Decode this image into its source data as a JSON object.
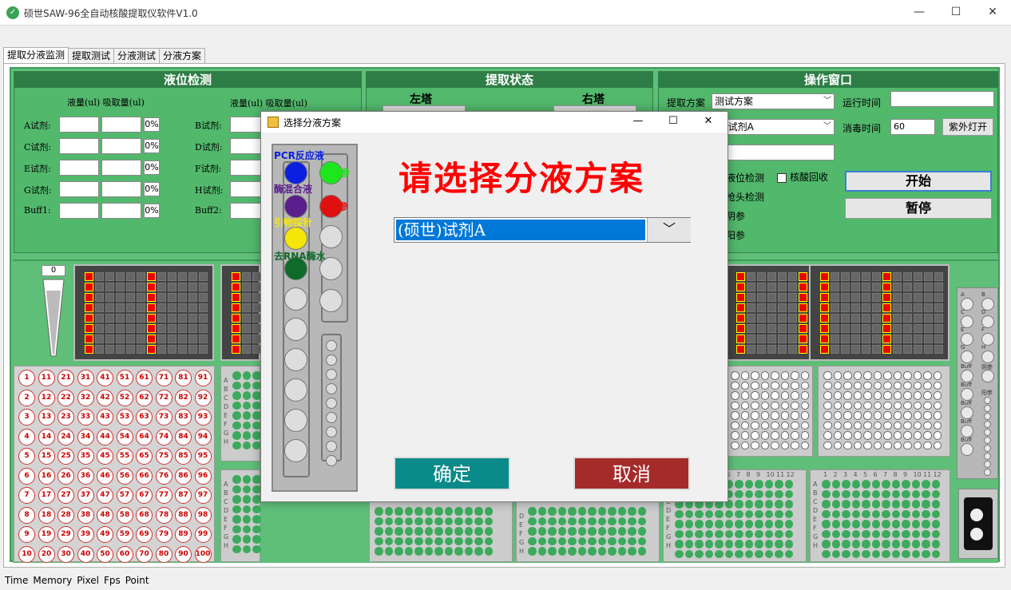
{
  "window": {
    "title": "硕世SAW-96全自动核酸提取仪软件V1.0",
    "minimize": "—",
    "maximize": "☐",
    "close": "✕"
  },
  "tabs": [
    "提取分液监测",
    "提取测试",
    "分液测试",
    "分液方案"
  ],
  "liquid_panel": {
    "title": "液位检测",
    "col_header_left": "液量(ul) 吸取量(ul)",
    "col_header_right": "液量(ul) 吸取量(ul)",
    "left_rows": [
      {
        "label": "A试剂:",
        "pct": "0%"
      },
      {
        "label": "C试剂:",
        "pct": "0%"
      },
      {
        "label": "E试剂:",
        "pct": "0%"
      },
      {
        "label": "G试剂:",
        "pct": "0%"
      },
      {
        "label": "Buff1:",
        "pct": "0%"
      }
    ],
    "right_rows": [
      {
        "label": "B试剂:"
      },
      {
        "label": "D试剂:"
      },
      {
        "label": "F试剂:"
      },
      {
        "label": "H试剂:"
      },
      {
        "label": "Buff2:"
      }
    ]
  },
  "extract_panel": {
    "title": "提取状态",
    "left_tower": "左塔",
    "right_tower": "右塔"
  },
  "operation_panel": {
    "title": "操作窗口",
    "scheme_label": "提取方案",
    "scheme_value": "测试方案",
    "reagent_value": "世)试剂A",
    "runtime_label": "运行时间",
    "runtime_value": "",
    "disinfect_label": "消毒时间",
    "disinfect_value": "60",
    "uv_button": "紫外灯开",
    "check_liquid": "液位检测",
    "check_recycle": "核酸回收",
    "tip_check": "枪头检测",
    "neg": "阴参",
    "pos": "阳参",
    "start_button": "开始",
    "pause_button": "暂停"
  },
  "pipette_counter": "0",
  "tube_rack_numbers": [
    [
      1,
      11,
      21,
      31,
      41,
      51,
      61,
      71,
      81,
      91
    ],
    [
      2,
      12,
      22,
      32,
      42,
      52,
      62,
      72,
      82,
      92
    ],
    [
      3,
      13,
      23,
      33,
      43,
      53,
      63,
      73,
      83,
      93
    ],
    [
      4,
      14,
      24,
      34,
      44,
      54,
      64,
      74,
      84,
      94
    ],
    [
      5,
      15,
      25,
      35,
      45,
      55,
      65,
      75,
      85,
      95
    ],
    [
      6,
      16,
      26,
      36,
      46,
      56,
      66,
      76,
      86,
      96
    ],
    [
      7,
      17,
      27,
      37,
      47,
      57,
      67,
      77,
      87,
      97
    ],
    [
      8,
      18,
      28,
      38,
      48,
      58,
      68,
      78,
      88,
      98
    ],
    [
      9,
      19,
      29,
      39,
      49,
      59,
      69,
      79,
      89,
      99
    ],
    [
      10,
      20,
      30,
      40,
      50,
      60,
      70,
      80,
      90,
      100
    ]
  ],
  "plate_row_letters": [
    "A",
    "B",
    "C",
    "D",
    "E",
    "F",
    "G",
    "H"
  ],
  "plate_col_numbers": [
    "1",
    "2",
    "3",
    "4",
    "5",
    "6",
    "7",
    "8",
    "9",
    "10",
    "11",
    "12"
  ],
  "reagent_rack_right": {
    "labels": [
      "A",
      "B",
      "C",
      "D",
      "E",
      "F",
      "G",
      "H",
      "Buff",
      "Buff",
      "Buff",
      "Buff",
      "Buff",
      "阴参",
      "阳参"
    ]
  },
  "statusbar": [
    "Time",
    "Memory",
    "Pixel",
    "Fps",
    "Point"
  ],
  "dialog": {
    "title": "选择分液方案",
    "heading": "请选择分液方案",
    "combo_value": "(硕世)试剂A",
    "confirm_button": "确定",
    "cancel_button": "取消",
    "rack_labels": {
      "pcr": "PCR反应液",
      "neg": "阴参",
      "enzyme": "酶混合液",
      "pos": "阳参",
      "primer": "引物探针",
      "water": "去RNA酶水"
    },
    "colors": {
      "pcr": "#0a1fe0",
      "neg": "#1ee61e",
      "enzyme": "#5a1f8c",
      "pos": "#e01010",
      "primer": "#f5e60a",
      "water": "#0f6b2a",
      "confirm": "#0b8a8a",
      "cancel": "#a52a2a",
      "heading": "#ff0000"
    }
  }
}
